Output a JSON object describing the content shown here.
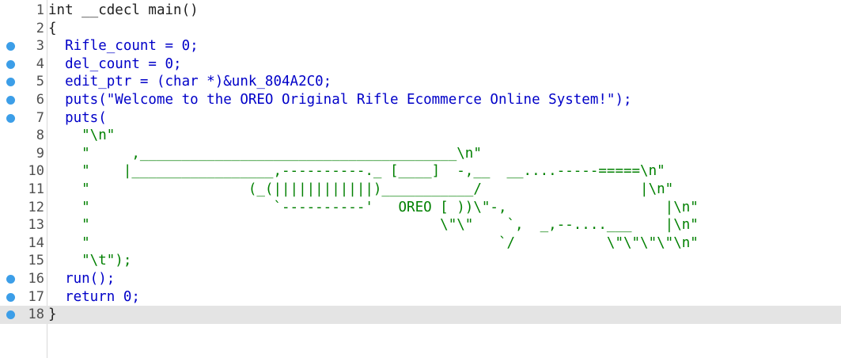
{
  "editor": {
    "current_line": 18,
    "lines": [
      {
        "num": "1",
        "bp": false,
        "text": "int __cdecl main()",
        "kind": "sig"
      },
      {
        "num": "2",
        "bp": false,
        "text": "{",
        "kind": "plain"
      },
      {
        "num": "3",
        "bp": true,
        "text": "  Rifle_count = 0;",
        "kind": "code"
      },
      {
        "num": "4",
        "bp": true,
        "text": "  del_count = 0;",
        "kind": "code"
      },
      {
        "num": "5",
        "bp": true,
        "text": "  edit_ptr = (char *)&unk_804A2C0;",
        "kind": "code"
      },
      {
        "num": "6",
        "bp": true,
        "text": "  puts(\"Welcome to the OREO Original Rifle Ecommerce Online System!\");",
        "kind": "code"
      },
      {
        "num": "7",
        "bp": true,
        "text": "  puts(",
        "kind": "code"
      },
      {
        "num": "8",
        "bp": false,
        "text": "    \"\\n\"",
        "kind": "str"
      },
      {
        "num": "9",
        "bp": false,
        "text": "    \"     ,______________________________________\\n\"",
        "kind": "str"
      },
      {
        "num": "10",
        "bp": false,
        "text": "    \"    |_________________,----------._ [____]  -,__  __....-----=====\\n\"",
        "kind": "str"
      },
      {
        "num": "11",
        "bp": false,
        "text": "    \"                   (_(||||||||||||)___________/                   |\\n\"",
        "kind": "str"
      },
      {
        "num": "12",
        "bp": false,
        "text": "    \"                      `----------'   OREO [ ))\\\"-,                   |\\n\"",
        "kind": "str"
      },
      {
        "num": "13",
        "bp": false,
        "text": "    \"                                          \\\"\\\"    `,  _,--....___    |\\n\"",
        "kind": "str"
      },
      {
        "num": "14",
        "bp": false,
        "text": "    \"                                                 `/           \\\"\\\"\\\"\\\"\\n\"",
        "kind": "str"
      },
      {
        "num": "15",
        "bp": false,
        "text": "    \"\\t\");",
        "kind": "str"
      },
      {
        "num": "16",
        "bp": true,
        "text": "  run();",
        "kind": "code"
      },
      {
        "num": "17",
        "bp": true,
        "text": "  return 0;",
        "kind": "code"
      },
      {
        "num": "18",
        "bp": true,
        "text": "}",
        "kind": "plain"
      }
    ]
  }
}
